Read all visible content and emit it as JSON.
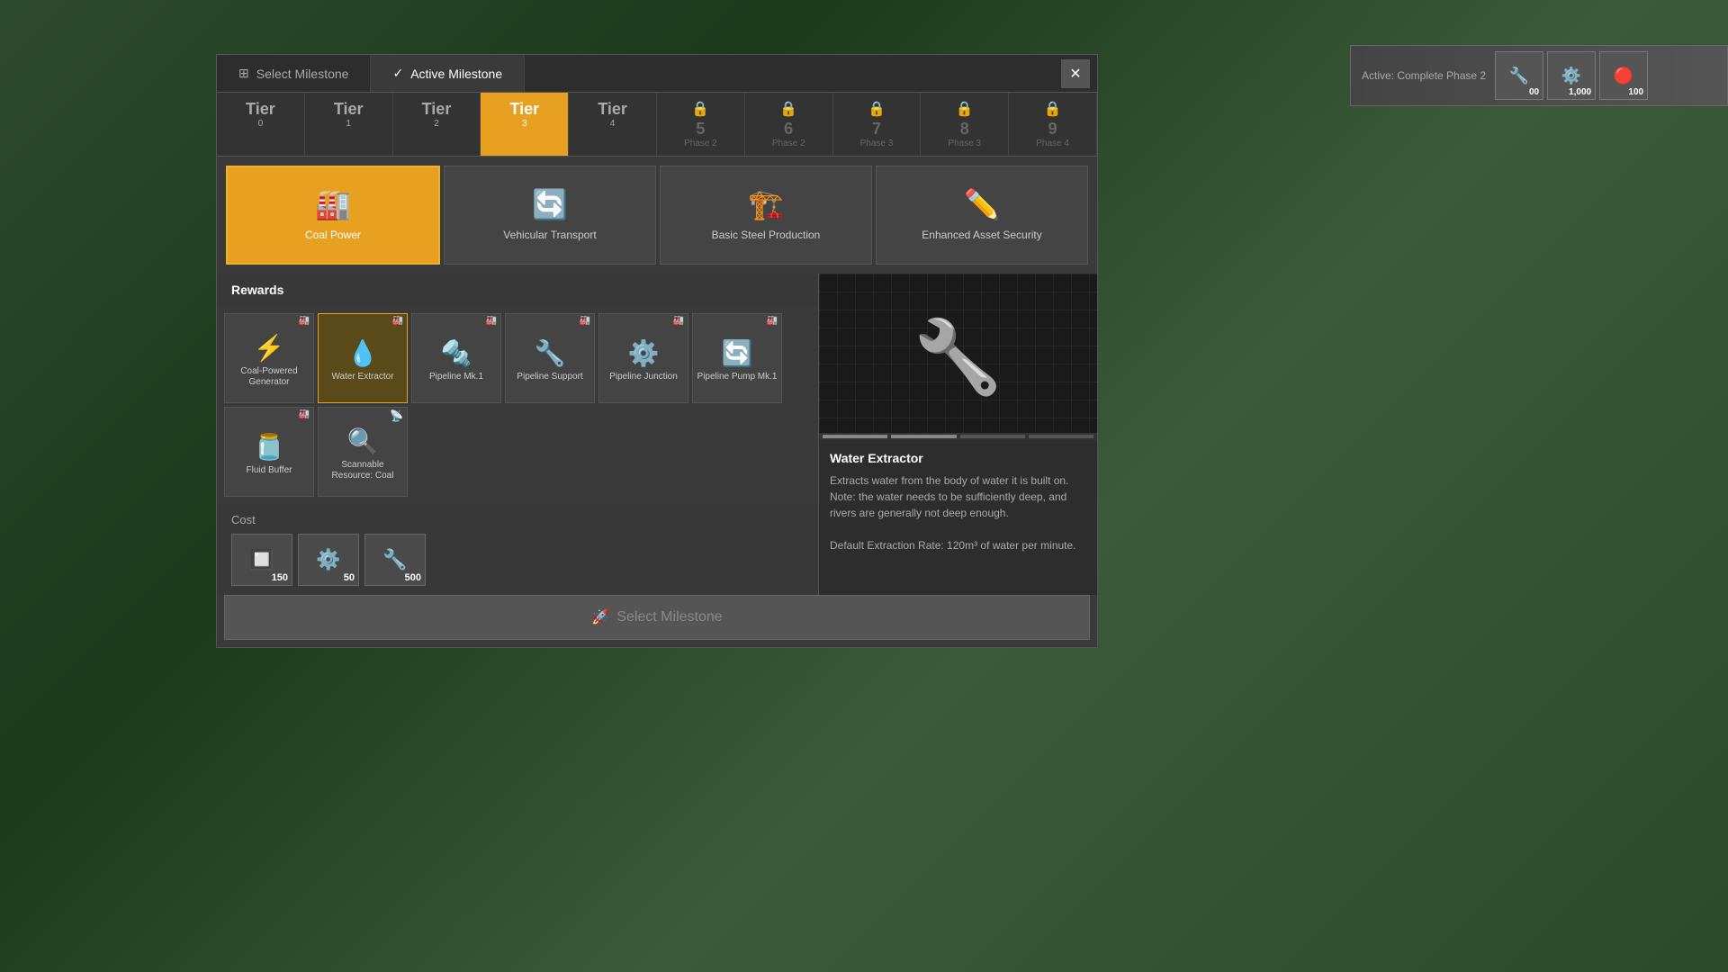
{
  "activebar": {
    "label": "Active: Complete Phase 2",
    "items": [
      {
        "icon": "🔧",
        "count": "00"
      },
      {
        "icon": "⚙️",
        "count": "1,000"
      },
      {
        "icon": "🔴",
        "count": "100"
      }
    ]
  },
  "tabs": {
    "select": "Select Milestone",
    "active": "Active Milestone"
  },
  "close": "✕",
  "tiers": [
    {
      "label": "Tier",
      "num": "0",
      "sub": "",
      "state": "normal"
    },
    {
      "label": "Tier",
      "num": "1",
      "sub": "",
      "state": "normal"
    },
    {
      "label": "Tier",
      "num": "2",
      "sub": "",
      "state": "normal"
    },
    {
      "label": "Tier",
      "num": "3",
      "sub": "",
      "state": "selected"
    },
    {
      "label": "Tier",
      "num": "4",
      "sub": "",
      "state": "normal"
    },
    {
      "label": "5",
      "num": "",
      "sub": "Phase 2",
      "state": "locked"
    },
    {
      "label": "6",
      "num": "",
      "sub": "Phase 2",
      "state": "locked"
    },
    {
      "label": "7",
      "num": "",
      "sub": "Phase 3",
      "state": "locked"
    },
    {
      "label": "8",
      "num": "",
      "sub": "Phase 3",
      "state": "locked"
    },
    {
      "label": "9",
      "num": "",
      "sub": "Phase 4",
      "state": "locked"
    }
  ],
  "milestones": [
    {
      "label": "Coal Power",
      "icon": "🏭",
      "state": "active"
    },
    {
      "label": "Vehicular Transport",
      "icon": "🔄",
      "state": "normal"
    },
    {
      "label": "Basic Steel Production",
      "icon": "🏗️",
      "state": "normal"
    },
    {
      "label": "Enhanced Asset Security",
      "icon": "✏️",
      "state": "normal"
    }
  ],
  "rewards_header": "Rewards",
  "rewards": [
    {
      "label": "Coal-Powered Generator",
      "icon": "⚡",
      "corner": "🏭",
      "selected": false
    },
    {
      "label": "Water Extractor",
      "icon": "💧",
      "corner": "🏭",
      "selected": true
    },
    {
      "label": "Pipeline Mk.1",
      "icon": "🔩",
      "corner": "🏭",
      "selected": false
    },
    {
      "label": "Pipeline Support",
      "icon": "🔧",
      "corner": "🏭",
      "selected": false
    },
    {
      "label": "Pipeline Junction",
      "icon": "⚙️",
      "corner": "🏭",
      "selected": false
    },
    {
      "label": "Pipeline Pump Mk.1",
      "icon": "🔄",
      "corner": "🏭",
      "selected": false
    },
    {
      "label": "Fluid Buffer",
      "icon": "🫙",
      "corner": "🏭",
      "selected": false
    },
    {
      "label": "Scannable Resource: Coal",
      "icon": "🔍",
      "corner": "📡",
      "selected": false,
      "wifi": true
    }
  ],
  "cost_label": "Cost",
  "cost_items": [
    {
      "icon": "🔲",
      "count": "150"
    },
    {
      "icon": "⚙️",
      "count": "50"
    },
    {
      "icon": "🔧",
      "count": "500"
    }
  ],
  "detail": {
    "title": "Water Extractor",
    "description": "Extracts water from the body of water it is built on. Note: the water needs to be sufficiently deep, and rivers are generally not deep enough.",
    "note": "Default Extraction Rate: 120m³ of water per minute."
  },
  "select_btn": "Select Milestone"
}
